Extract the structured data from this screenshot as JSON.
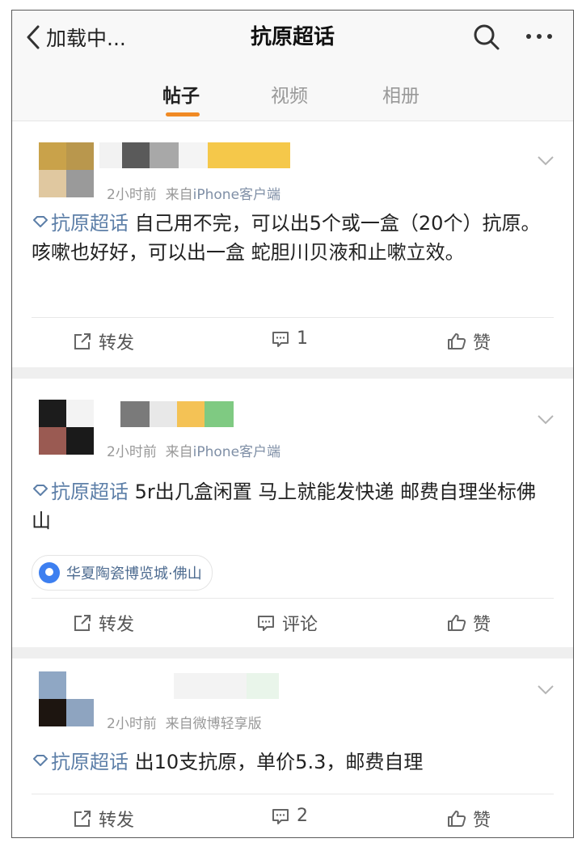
{
  "header": {
    "back_label": "加载中...",
    "title": "抗原超话",
    "icons": [
      "back-chevron-icon",
      "search-icon",
      "more-icon"
    ]
  },
  "tabs": [
    {
      "label": "帖子",
      "active": true
    },
    {
      "label": "视频",
      "active": false
    },
    {
      "label": "相册",
      "active": false
    }
  ],
  "accent_color": "#f08a24",
  "topic_color": "#5d7fa8",
  "posts": [
    {
      "time": "2小时前",
      "source_prefix": "来自",
      "source": "iPhone客户端",
      "topic": "抗原超话",
      "text": "自己用不完，可以出5个或一盒（20个）抗原。咳嗽也好好，可以出一盒 蛇胆川贝液和止嗽立效。",
      "actions": {
        "repost": "转发",
        "comment": "1",
        "like": "赞"
      }
    },
    {
      "time": "2小时前",
      "source_prefix": "来自",
      "source": "iPhone客户端",
      "topic": "抗原超话",
      "text": "5r出几盒闲置 马上就能发快递 邮费自理坐标佛山",
      "location": "华夏陶瓷博览城·佛山",
      "actions": {
        "repost": "转发",
        "comment": "评论",
        "like": "赞"
      }
    },
    {
      "time": "2小时前",
      "source_prefix": "来自",
      "source": "微博轻享版",
      "topic": "抗原超话",
      "text": "出10支抗原，单价5.3，邮费自理",
      "actions": {
        "repost": "转发",
        "comment": "2",
        "like": "赞"
      }
    }
  ]
}
